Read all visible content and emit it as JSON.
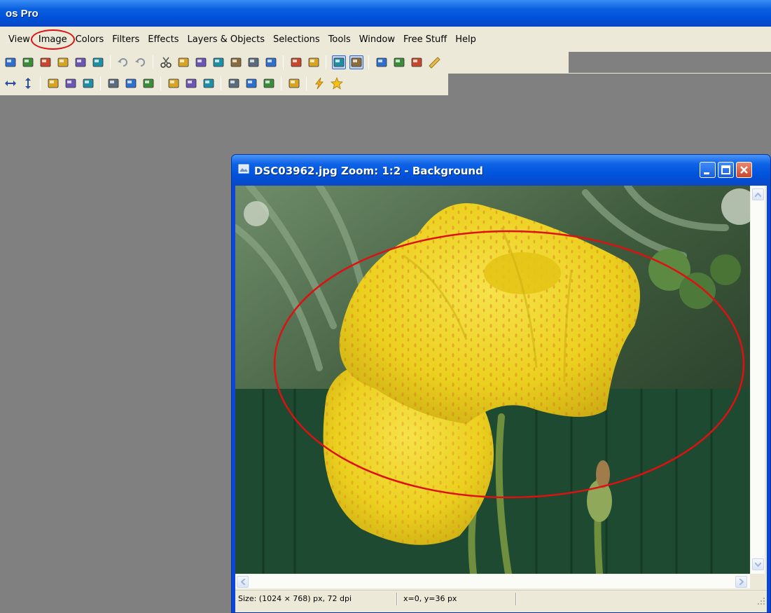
{
  "app": {
    "title": "os Pro"
  },
  "menu": [
    "View",
    "Image",
    "Colors",
    "Filters",
    "Effects",
    "Layers & Objects",
    "Selections",
    "Tools",
    "Window",
    "Free Stuff",
    "Help"
  ],
  "menu_highlighted": "Image",
  "toolbar_row1": [
    "new-icon",
    "save-icon",
    "save-all-icon",
    "print-icon",
    "print-preview-icon",
    "scan-icon",
    "sep",
    "undo-icon",
    "redo-icon",
    "sep",
    "cut-icon",
    "copy-icon",
    "copy-merged-icon",
    "paste-icon",
    "paste-into-icon",
    "paste-new-icon",
    "screen-capture-icon",
    "sep",
    "open-browser-icon",
    "image-info-icon",
    "sep",
    "tools-icon",
    "layers-icon",
    "sep",
    "grid-icon",
    "navigator-icon",
    "window-icon",
    "ruler-icon"
  ],
  "toolbar_row2": [
    "flip-horizontal-icon",
    "flip-vertical-icon",
    "sep",
    "invert-icon",
    "color-balance-icon",
    "hue-icon",
    "sep",
    "brightness-icon",
    "contrast-icon",
    "red-eye-icon",
    "sep",
    "resize-icon",
    "canvas-icon",
    "histogram-icon",
    "sep",
    "frame-icon",
    "noise-icon",
    "landscape-icon",
    "sep",
    "stamp-icon",
    "sep",
    "lightning-icon",
    "star-icon"
  ],
  "document": {
    "title": "DSC03962.jpg  Zoom: 1:2 - Background",
    "status_size": "Size: (1024 × 768) px, 72 dpi",
    "status_coords": "x=0, y=36 px"
  },
  "colors": {
    "xp_blue": "#0a58dc",
    "menu_bg": "#ece9d8",
    "annotation_red": "#dd1111",
    "workspace": "#808080"
  }
}
